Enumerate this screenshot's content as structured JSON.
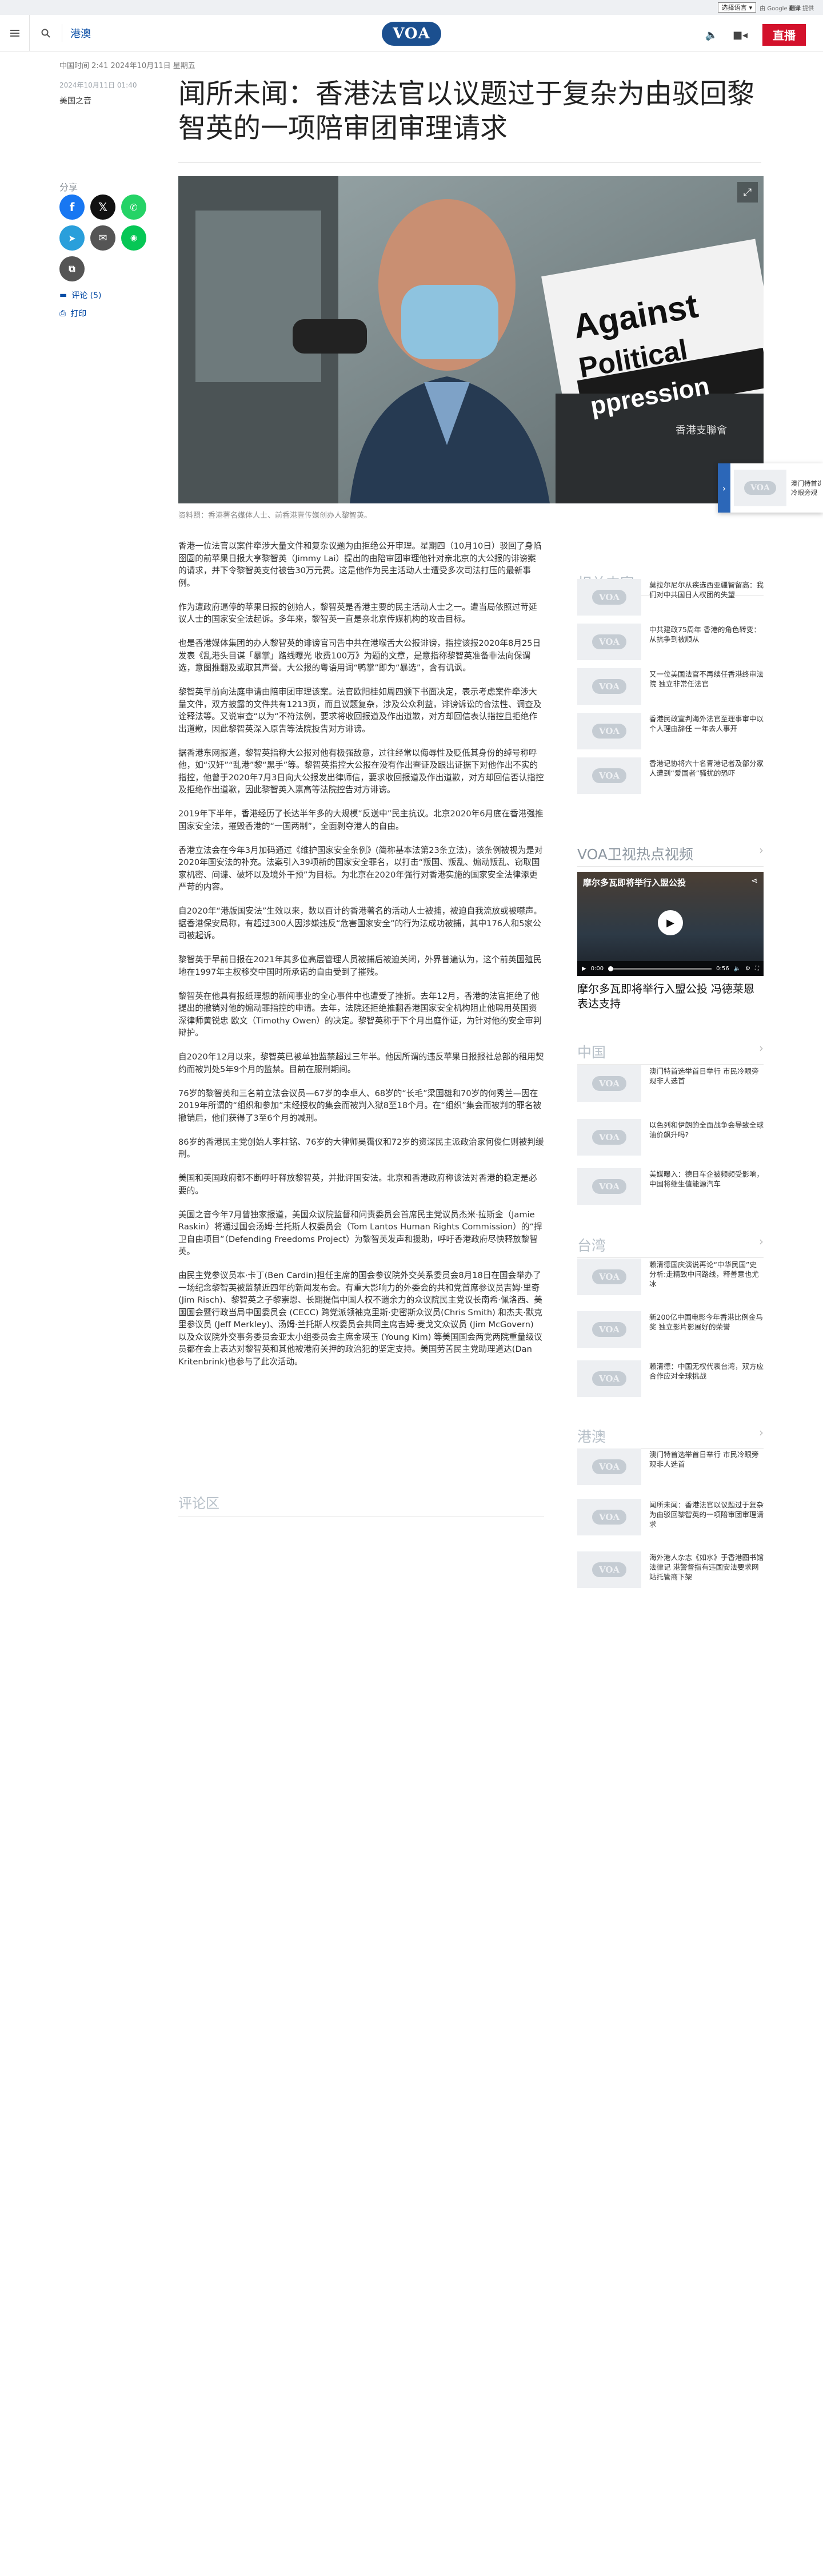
{
  "topbar": {
    "language_select": "选择语言",
    "google_badge_prefix": "由 Google",
    "google_badge_brand": "翻译",
    "google_badge_suffix": "提供"
  },
  "header": {
    "section": "港澳",
    "logo": "VOA",
    "live": "直播"
  },
  "article": {
    "updated": "中国时间 2:41 2024年10月11日 星期五",
    "date": "2024年10月11日 01:40",
    "category": "美国之音",
    "title": "闻所未闻：香港法官以议题过于复杂为由驳回黎智英的一项陪审团审理请求",
    "share_label": "分享",
    "comments_link": "评论 (5)",
    "print_link": "打印",
    "caption": "资料照：香港著名媒体人士、前香港壹传媒创办人黎智英。",
    "hero_sign_line1": "Against",
    "hero_sign_line2": "Political",
    "hero_sign_line3": "ppression",
    "hero_sign_cn": "香港支聯會",
    "paragraphs": [
      "香港一位法官以案件牵涉大量文件和复杂议题为由拒绝公开审理。星期四（10月10日）驳回了身陷囹圄的前苹果日报大亨黎智英（Jimmy Lai）提出的由陪审团审理他针对亲北京的大公报的诽谤案的请求，并下令黎智英支付被告30万元费。这是他作为民主活动人士遭受多次司法打压的最新事例。",
      "作为遭政府逼停的苹果日报的创始人，黎智英是香港主要的民主活动人士之一。遭当局依照过苛延议人士的国家安全法起诉。多年来，黎智英一直是亲北京传媒机构的攻击目标。",
      "也是香港媒体集团的办人黎智英的诽谤官司告中共在港喉舌大公报诽谤，指控该报2020年8月25日发表《乱港头目谋「暴掌」路线曝光 收费100万》为题的文章，是意指称黎智英准备非法向保谓选，意图推翻及或取其声誉。大公报的粤语用词“鸭掌”即为“暴选”，含有讥讽。",
      "黎智英早前向法庭申请由陪审团审理该案。法官欧阳桂如周四颁下书面决定，表示考虑案件牵涉大量文件，双方披露的文件共有1213页，而且议题复杂，涉及公众利益，诽谤诉讼的合法性、调查及诠释法等。又说审查“以为“不符法例，要求将收回报道及作出道歉，对方却回信表认指控且拒绝作出道歉，因此黎智英深入原告等法院投告对方诽谤。",
      "据香港东网报道，黎智英指称大公报对他有极强敌意，过往经常以侮辱性及贬低其身份的绰号称呼他，如“汉奸”“乱港”黎“黑手”等。黎智英指控大公报在没有作出查证及跟出证据下对他作出不实的指控，他曾于2020年7月3日向大公报发出律师信，要求收回报道及作出道歉，对方却回信否认指控及拒绝作出道歉，因此黎智英入禀高等法院控告对方诽谤。",
      "2019年下半年，香港经历了长达半年多的大规模“反送中”民主抗议。北京2020年6月底在香港强推国家安全法，摧毁香港的“一国两制”，全面剥夺港人的自由。",
      "香港立法会在今年3月加码通过《维护国家安全条例》(简称基本法第23条立法)，该条例被视为是对2020年国安法的补充。法案引入39项新的国家安全罪名，以打击“叛国、叛乱、煽动叛乱、窃取国家机密、间谍、破坏以及境外干预”为目标。为北京在2020年强行对香港实施的国家安全法律添更严苛的内容。",
      "自2020年“港版国安法”生效以来，数以百计的香港著名的活动人士被捕，被迫自我流放或被噤声。据香港保安局称，有超过300人因涉嫌违反“危害国家安全”的行为法成功被捕，其中176人和5家公司被起诉。",
      "黎智英于早前日报在2021年其多位高层管理人员被捕后被迫关闭，外界普遍认为，这个前英国殖民地在1997年主权移交中国时所承诺的自由受到了摧残。",
      "黎智英在他具有报纸理想的新闻事业的全心事件中也遭受了挫折。去年12月，香港的法官拒绝了他提出的撤销对他的煽动罪指控的申请。去年，法院还拒绝推翻香港国家安全机构阻止他聘用英国资深律师黄锐忠 欧文（Timothy Owen）的决定。黎智英称于下个月出庭作证，为针对他的安全审判辩护。",
      "自2020年12月以来，黎智英已被单独监禁超过三年半。他因所谓的违反苹果日报报社总部的租用契约而被判处5年9个月的监禁。目前在服刑期间。",
      "76岁的黎智英和三名前立法会议员—67岁的李卓人、68岁的“长毛”梁国雄和70岁的何秀兰—因在2019年所谓的“组织和参加”未经授权的集会而被判入狱8至18个月。在“组织”集会而被判的罪名被撤销后，他们获得了3至6个月的减刑。",
      "86岁的香港民主党创始人李柱铭、76岁的大律师吴霭仪和72岁的资深民主派政治家何俊仁则被判缓刑。",
      "美国和英国政府都不断呼吁释放黎智英，并批评国安法。北京和香港政府称该法对香港的稳定是必要的。",
      "美国之音今年7月曾独家报道，美国众议院监督和问责委员会首席民主党议员杰米·拉斯金（Jamie Raskin）将通过国会汤姆·兰托斯人权委员会（Tom Lantos Human Rights Commission）的“捍卫自由项目”（Defending Freedoms Project）为黎智英发声和援助，呼吁香港政府尽快释放黎智英。",
      "由民主党参议员本·卡丁(Ben Cardin)担任主席的国会参议院外交关系委员会8月18日在国会举办了一场纪念黎智英被监禁近四年的新闻发布会。有重大影响力的外委会的共和党首席参议员吉姆·里奇(Jim Risch)、黎智英之子黎崇恩、长期提倡中国人权不遗余力的众议院民主党议长南希·佩洛西、美国国会暨行政当局中国委员会 (CECC) 跨党派领袖克里斯·史密斯众议员(Chris Smith) 和杰夫·默克里参议员 (Jeff Merkley)、汤姆·兰托斯人权委员会共同主席吉姆·麦戈文众议员 (Jim McGovern) 以及众议院外交事务委员会亚太小组委员会主席金瑛玉 (Young Kim) 等美国国会两党两院重量级议员都在会上表达对黎智英和其他被港府关押的政治犯的坚定支持。美国劳苦民主党助理道达(Dan Kritenbrink)也参与了此次活动。"
    ],
    "comments_heading": "评论区"
  },
  "rail": {
    "related": {
      "heading": "相关内容",
      "items": [
        "莫拉尔尼尔从疾选西亚疆智留高：我们对中共国日人权团的失望",
        "中共建政75周年 香港的角色转变：从抗争到被顺从",
        "又一位美国法官不再续任香港终审法院 独立非常任法官",
        "香港民政宣判海外法官至理事审中以个人理由辞任 一年去人事开",
        "香港记协将六十名青港记者及部分家人遭到“爱国者”骚扰的恐吓"
      ]
    },
    "video": {
      "heading": "VOA卫视热点视频",
      "overlay_title": "摩尔多瓦即将举行入盟公投",
      "title": "摩尔多瓦即将举行入盟公投 冯德莱恩表达支持",
      "time_current": "0:00",
      "time_total": "0:56"
    },
    "china": {
      "heading": "中国",
      "items": [
        "澳门特首选举首日举行 市民冷眼旁观非人选首",
        "以色列和伊朗的全面战争会导致全球油价飙升吗?",
        "美媒曝入：德日车企被频频受影响，中国将继生值能源汽车"
      ]
    },
    "taiwan": {
      "heading": "台湾",
      "items": [
        "赖清德国庆演说再论“中华民国”史 分析:走精致中间路线，释善意也尤冰",
        "新200亿中国电影今年香港比例金马奖 独立影片影展好的荣誉",
        "赖清德：中国无权代表台湾，双方应合作应对全球挑战"
      ]
    },
    "hkmacau": {
      "heading": "港澳",
      "items": [
        "澳门特首选举首日举行 市民冷眼旁观非人选首",
        "闻所未闻：香港法官以议题过于复杂为由驳回黎智英的一项陪审团审理请求",
        "海外港人杂志《如水》于香港图书馆法律记 港警督指有违国安法要求网站托管商下架"
      ]
    }
  },
  "floating": {
    "text_line1": "澳门特首选",
    "text_line2": "冷眼旁观"
  }
}
